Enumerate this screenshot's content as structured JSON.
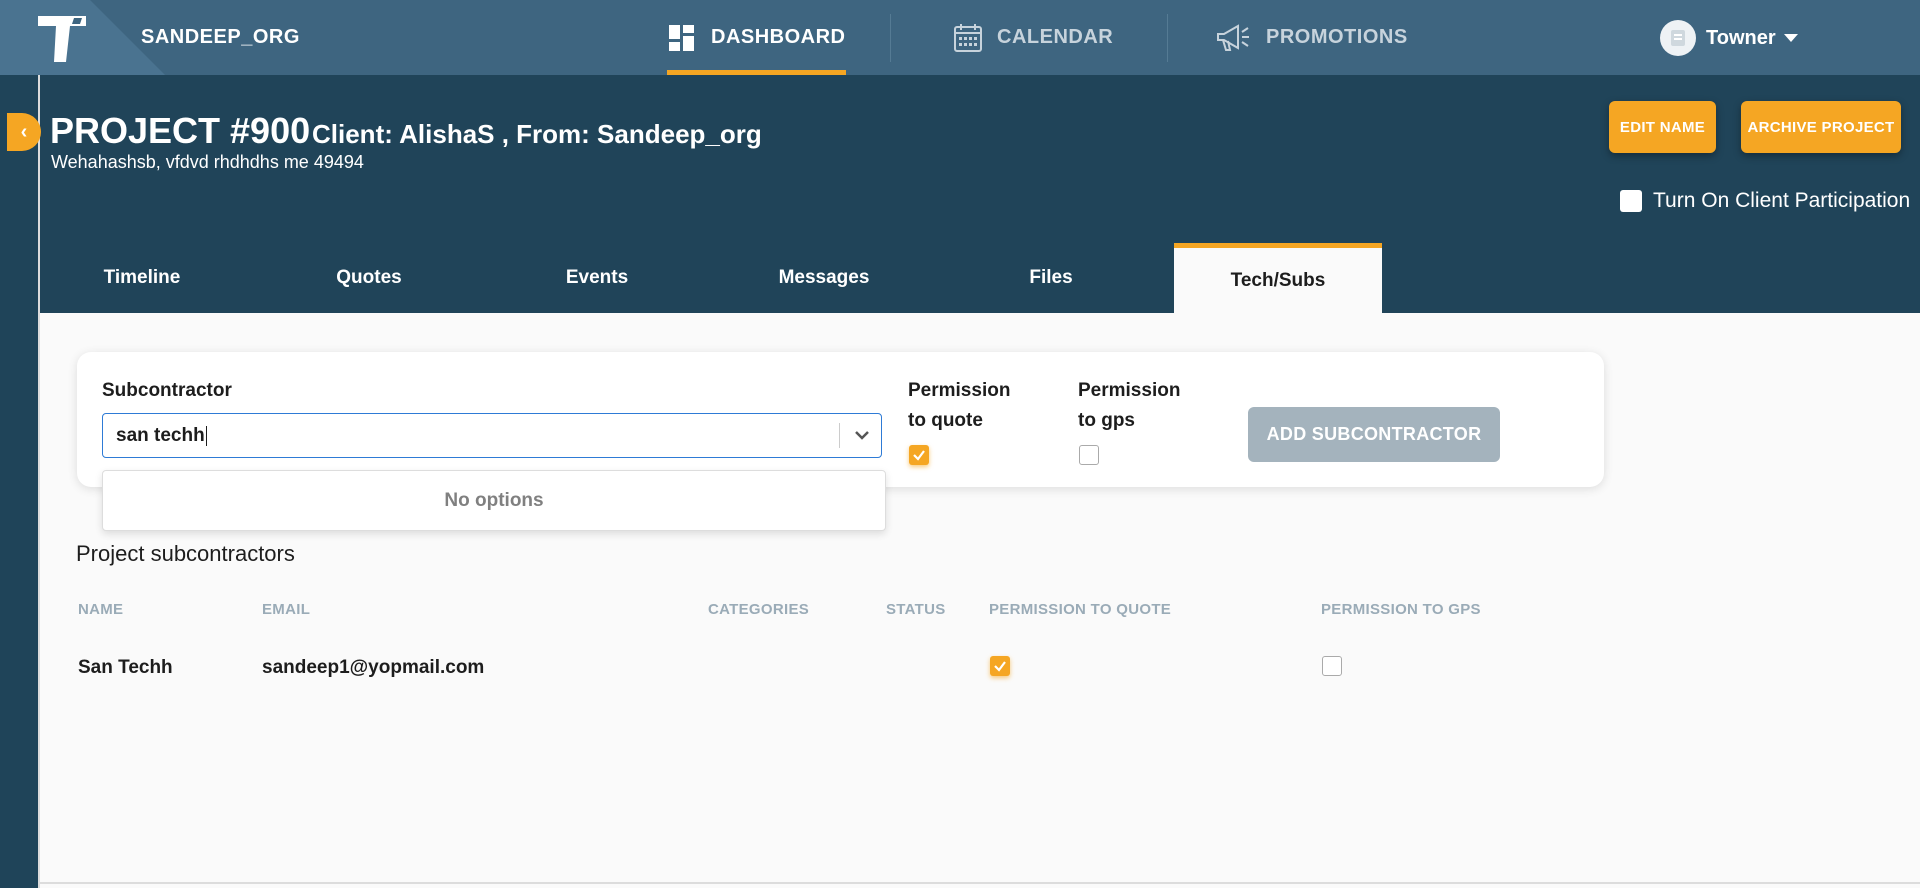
{
  "org": {
    "name": "SANDEEP_ORG",
    "logo_icon": "t-logo-icon"
  },
  "nav": [
    {
      "label": "DASHBOARD",
      "icon": "dashboard-icon",
      "active": true
    },
    {
      "label": "CALENDAR",
      "icon": "calendar-icon",
      "active": false
    },
    {
      "label": "PROMOTIONS",
      "icon": "megaphone-icon",
      "active": false
    }
  ],
  "user": {
    "name": "Towner"
  },
  "project": {
    "title": "PROJECT #900",
    "client_line": "Client: AlishaS , From: Sandeep_org",
    "address": "Wehahashsb, vfdvd rhdhdhs me 49494",
    "edit_name_label": "EDIT NAME",
    "archive_label": "ARCHIVE PROJECT",
    "participation_label": "Turn On Client Participation",
    "participation_checked": false
  },
  "tabs": [
    {
      "label": "Timeline",
      "active": false
    },
    {
      "label": "Quotes",
      "active": false
    },
    {
      "label": "Events",
      "active": false
    },
    {
      "label": "Messages",
      "active": false
    },
    {
      "label": "Files",
      "active": false
    },
    {
      "label": "Tech/Subs",
      "active": true
    }
  ],
  "form": {
    "subcontractor_label": "Subcontractor",
    "subcontractor_value": "san techh",
    "no_options": "No options",
    "perm_quote_line1": "Permission",
    "perm_quote_line2": "to quote",
    "perm_quote_checked": true,
    "perm_gps_line1": "Permission",
    "perm_gps_line2": "to gps",
    "perm_gps_checked": false,
    "add_button": "ADD SUBCONTRACTOR"
  },
  "table": {
    "title": "Project subcontractors",
    "columns": [
      "NAME",
      "EMAIL",
      "CATEGORIES",
      "STATUS",
      "PERMISSION TO QUOTE",
      "PERMISSION TO GPS"
    ],
    "rows": [
      {
        "name": "San Techh",
        "email": "sandeep1@yopmail.com",
        "categories": "",
        "status": "",
        "perm_quote": true,
        "perm_gps": false
      }
    ]
  },
  "colors": {
    "accent": "#f5a623",
    "nav_bg": "#3e6580",
    "header_bg": "#204459",
    "focus": "#2e7bd6"
  }
}
